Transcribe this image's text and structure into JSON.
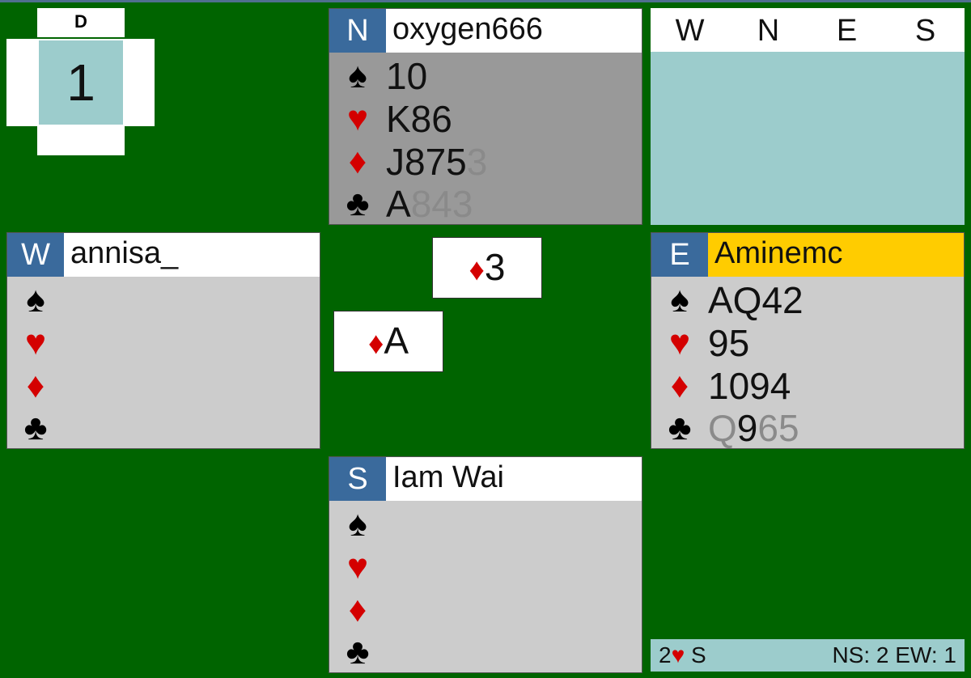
{
  "board": {
    "dealer": "D",
    "number": "1"
  },
  "bidding": {
    "columns": [
      "W",
      "N",
      "E",
      "S"
    ]
  },
  "north": {
    "seat": "N",
    "name": "oxygen666",
    "spades": {
      "live": "10",
      "played": ""
    },
    "hearts": {
      "live": "K86",
      "played": ""
    },
    "diamonds": {
      "live": "J875",
      "played": "3"
    },
    "clubs": {
      "live": "A",
      "played": "843"
    }
  },
  "west": {
    "seat": "W",
    "name": "annisa_",
    "spades": "",
    "hearts": "",
    "diamonds": "",
    "clubs": ""
  },
  "east": {
    "seat": "E",
    "name": "Aminemc",
    "spades": "AQ42",
    "hearts": "95",
    "diamonds": "1094",
    "clubs": {
      "p1": "Q",
      "live": "9",
      "p2": "65"
    }
  },
  "south": {
    "seat": "S",
    "name": "Iam Wai",
    "spades": "",
    "hearts": "",
    "diamonds": "",
    "clubs": ""
  },
  "trick": {
    "north": {
      "suit": "♦",
      "rank": "3"
    },
    "west": {
      "suit": "♦",
      "rank": "A"
    }
  },
  "suits": {
    "spade": "♠",
    "heart": "♥",
    "diamond": "♦",
    "club": "♣"
  },
  "status": {
    "level": "2",
    "suit": "♥",
    "declarer": "S",
    "score": "NS: 2 EW: 1"
  },
  "colors": {
    "felt": "#006400",
    "seat": "#3a6a9c",
    "active": "#ffcc00",
    "panel": "#9ccccc",
    "red_suit": "#d40000"
  }
}
